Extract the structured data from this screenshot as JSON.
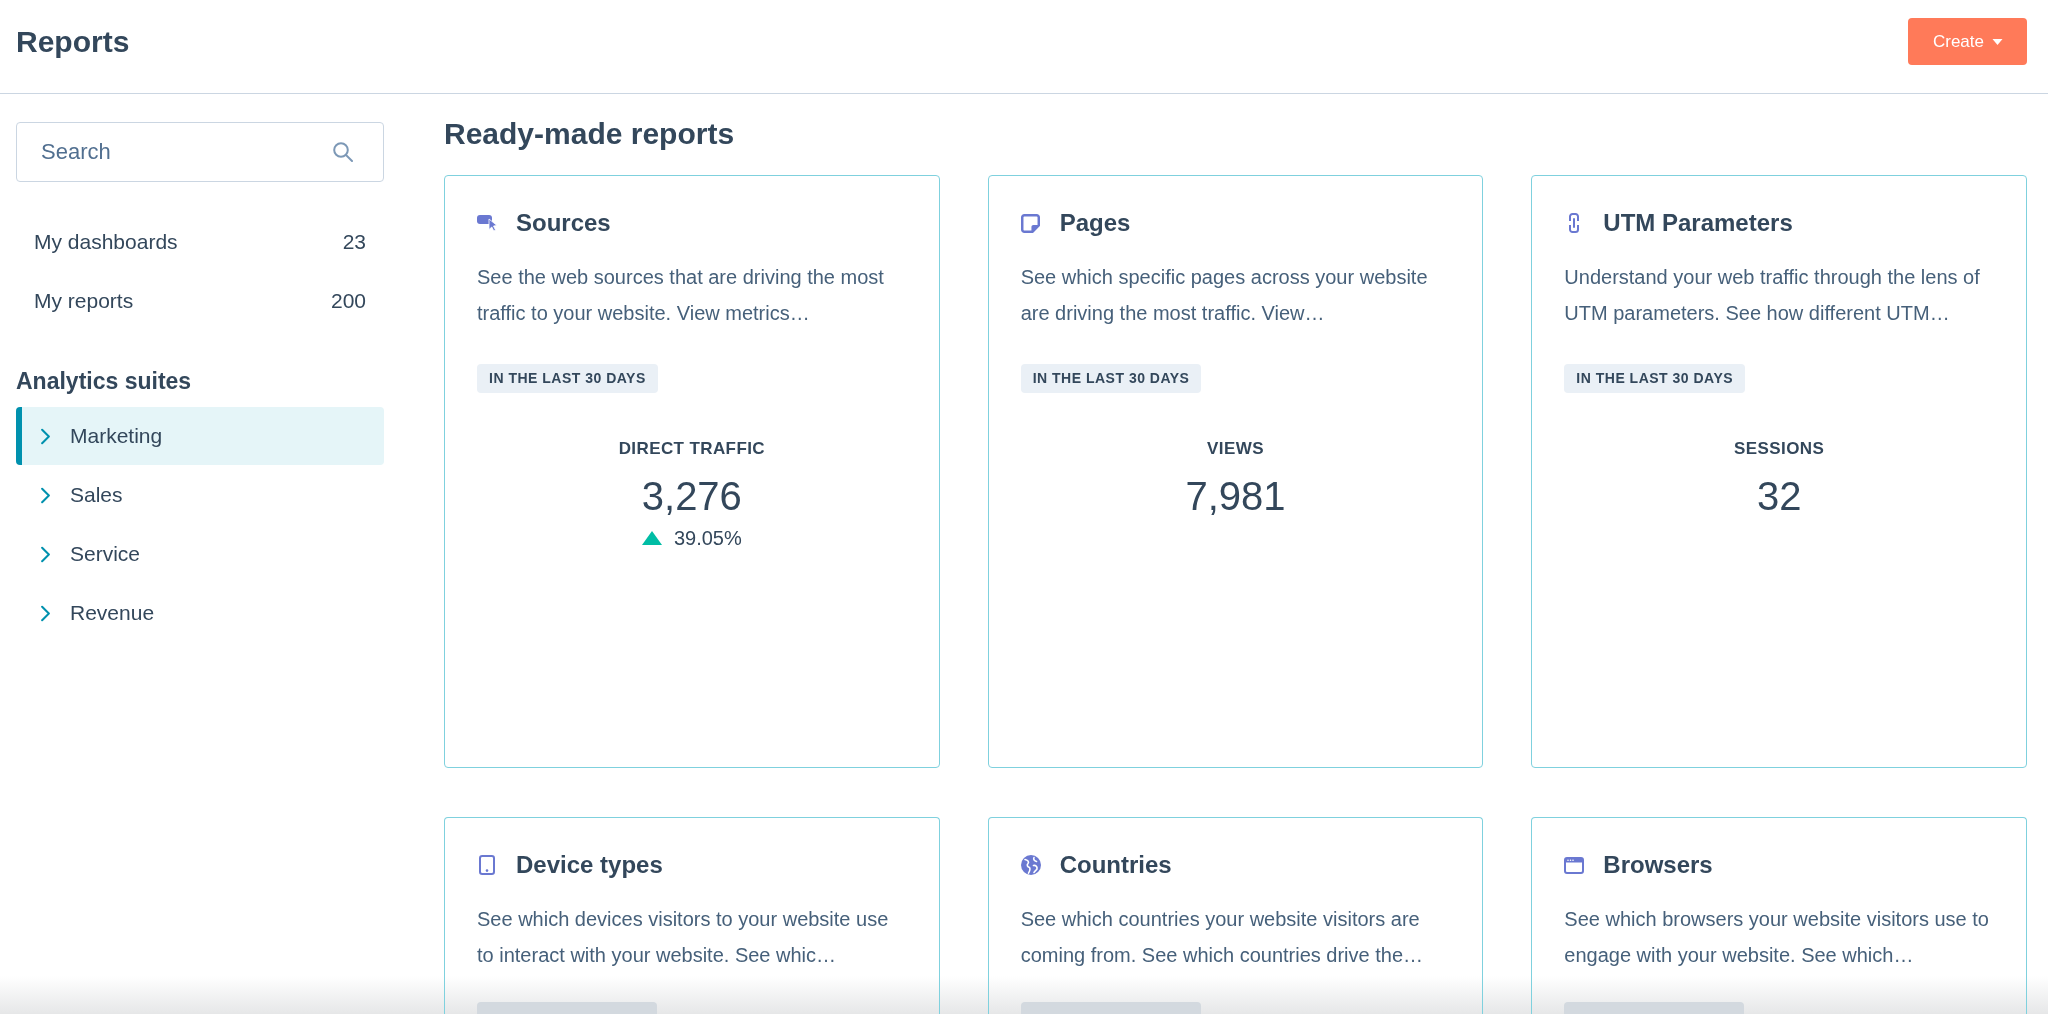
{
  "header": {
    "title": "Reports",
    "create_button": {
      "label": "Create"
    }
  },
  "sidebar": {
    "search": {
      "placeholder": "Search"
    },
    "links": [
      {
        "label": "My dashboards",
        "count": "23"
      },
      {
        "label": "My reports",
        "count": "200"
      }
    ],
    "section_title": "Analytics suites",
    "suites": [
      {
        "label": "Marketing",
        "selected": true,
        "expanded": false
      },
      {
        "label": "Sales",
        "selected": false,
        "expanded": false
      },
      {
        "label": "Service",
        "selected": false,
        "expanded": false
      },
      {
        "label": "Revenue",
        "selected": false,
        "expanded": false
      }
    ]
  },
  "main": {
    "title": "Ready-made reports",
    "cards": [
      {
        "title": "Sources",
        "description": "See the web sources that are driving the most traffic to your website. View metrics…",
        "badge": "IN THE LAST 30 DAYS",
        "metric": {
          "label": "DIRECT TRAFFIC",
          "value": "3,276",
          "change": {
            "increase": true,
            "text": "39.05%"
          }
        }
      },
      {
        "title": "Pages",
        "description": "See which specific pages across your website are driving the most traffic. View…",
        "badge": "IN THE LAST 30 DAYS",
        "metric": {
          "label": "VIEWS",
          "value": "7,981"
        }
      },
      {
        "title": "UTM Parameters",
        "description": "Understand your web traffic through the lens of UTM parameters. See how different UTM…",
        "badge": "IN THE LAST 30 DAYS",
        "metric": {
          "label": "SESSIONS",
          "value": "32"
        }
      },
      {
        "title": "Device types",
        "description": "See which devices visitors to your website use to interact with your website. See whic…"
      },
      {
        "title": "Countries",
        "description": "See which countries your website visitors are coming from. See which countries drive the…"
      },
      {
        "title": "Browsers",
        "description": "See which browsers your website visitors use to engage with your website. See which…"
      }
    ]
  }
}
